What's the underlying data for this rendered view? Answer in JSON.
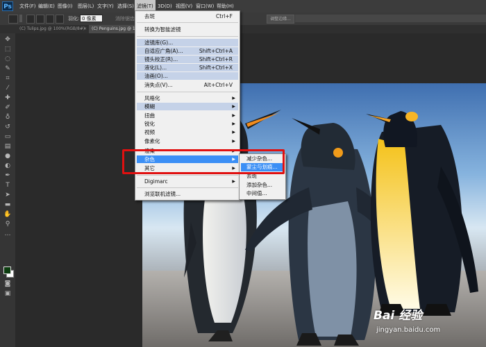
{
  "menubar": {
    "logo": "Ps",
    "items": [
      {
        "label": "文件(F)"
      },
      {
        "label": "编辑(E)"
      },
      {
        "label": "图像(I)"
      },
      {
        "label": "图层(L)"
      },
      {
        "label": "文字(Y)"
      },
      {
        "label": "选择(S)"
      },
      {
        "label": "滤镜(T)"
      },
      {
        "label": "3D(D)"
      },
      {
        "label": "视图(V)"
      },
      {
        "label": "窗口(W)"
      },
      {
        "label": "帮助(H)"
      }
    ]
  },
  "options": {
    "feather_label": "羽化:",
    "feather_value": "0 像素",
    "antialias_label": "消除锯齿",
    "refine_edge_label": "调整边缘..."
  },
  "tabs": [
    {
      "label": "(C) Tulips.jpg @ 100%(RGB/8#)"
    },
    {
      "label": "(C) Penguins.jpg @ 1"
    }
  ],
  "filter_menu": {
    "items": [
      {
        "label": "去斑",
        "shortcut": "Ctrl+F"
      },
      {
        "label": "转换为智能滤镜"
      },
      {
        "label": "滤镜库(G)..."
      },
      {
        "label": "自适应广角(A)...",
        "shortcut": "Shift+Ctrl+A"
      },
      {
        "label": "镜头校正(R)...",
        "shortcut": "Shift+Ctrl+R"
      },
      {
        "label": "液化(L)...",
        "shortcut": "Shift+Ctrl+X"
      },
      {
        "label": "油画(O)..."
      },
      {
        "label": "消失点(V)...",
        "shortcut": "Alt+Ctrl+V"
      },
      {
        "label": "风格化"
      },
      {
        "label": "模糊"
      },
      {
        "label": "扭曲"
      },
      {
        "label": "锐化"
      },
      {
        "label": "视频"
      },
      {
        "label": "像素化"
      },
      {
        "label": "渲染"
      },
      {
        "label": "杂色"
      },
      {
        "label": "其它"
      },
      {
        "label": "Digimarc"
      },
      {
        "label": "浏览联机滤镜..."
      }
    ]
  },
  "noise_submenu": {
    "items": [
      {
        "label": "减少杂色..."
      },
      {
        "label": "蒙尘与划痕..."
      },
      {
        "label": "去斑"
      },
      {
        "label": "添加杂色..."
      },
      {
        "label": "中间值..."
      }
    ]
  },
  "watermark": {
    "main": "Bai 经验",
    "sub": "jingyan.baidu.com"
  },
  "colors": {
    "selection": "#3b8ff5",
    "highlight": "#c5d2e8",
    "annotation": "#e01010",
    "foreground_swatch": "#0d3d10",
    "background_swatch": "#ffffff"
  }
}
